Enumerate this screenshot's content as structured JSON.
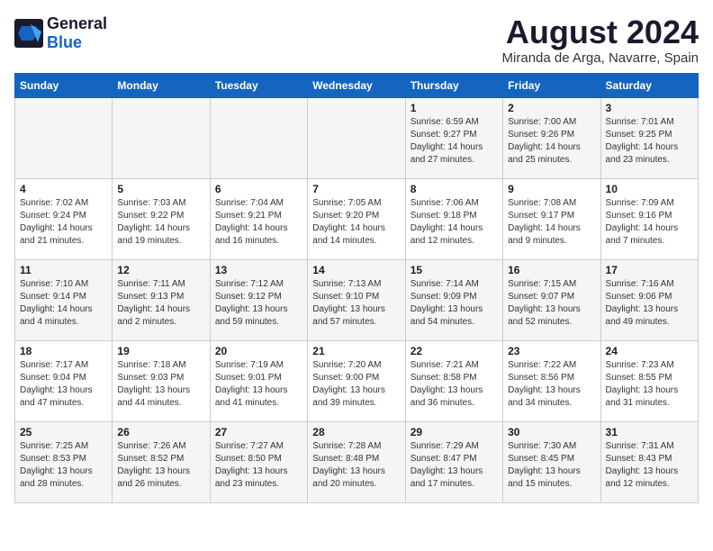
{
  "logo": {
    "general": "General",
    "blue": "Blue"
  },
  "title": {
    "month_year": "August 2024",
    "location": "Miranda de Arga, Navarre, Spain"
  },
  "days_of_week": [
    "Sunday",
    "Monday",
    "Tuesday",
    "Wednesday",
    "Thursday",
    "Friday",
    "Saturday"
  ],
  "weeks": [
    [
      {
        "day": "",
        "info": ""
      },
      {
        "day": "",
        "info": ""
      },
      {
        "day": "",
        "info": ""
      },
      {
        "day": "",
        "info": ""
      },
      {
        "day": "1",
        "info": "Sunrise: 6:59 AM\nSunset: 9:27 PM\nDaylight: 14 hours and 27 minutes."
      },
      {
        "day": "2",
        "info": "Sunrise: 7:00 AM\nSunset: 9:26 PM\nDaylight: 14 hours and 25 minutes."
      },
      {
        "day": "3",
        "info": "Sunrise: 7:01 AM\nSunset: 9:25 PM\nDaylight: 14 hours and 23 minutes."
      }
    ],
    [
      {
        "day": "4",
        "info": "Sunrise: 7:02 AM\nSunset: 9:24 PM\nDaylight: 14 hours and 21 minutes."
      },
      {
        "day": "5",
        "info": "Sunrise: 7:03 AM\nSunset: 9:22 PM\nDaylight: 14 hours and 19 minutes."
      },
      {
        "day": "6",
        "info": "Sunrise: 7:04 AM\nSunset: 9:21 PM\nDaylight: 14 hours and 16 minutes."
      },
      {
        "day": "7",
        "info": "Sunrise: 7:05 AM\nSunset: 9:20 PM\nDaylight: 14 hours and 14 minutes."
      },
      {
        "day": "8",
        "info": "Sunrise: 7:06 AM\nSunset: 9:18 PM\nDaylight: 14 hours and 12 minutes."
      },
      {
        "day": "9",
        "info": "Sunrise: 7:08 AM\nSunset: 9:17 PM\nDaylight: 14 hours and 9 minutes."
      },
      {
        "day": "10",
        "info": "Sunrise: 7:09 AM\nSunset: 9:16 PM\nDaylight: 14 hours and 7 minutes."
      }
    ],
    [
      {
        "day": "11",
        "info": "Sunrise: 7:10 AM\nSunset: 9:14 PM\nDaylight: 14 hours and 4 minutes."
      },
      {
        "day": "12",
        "info": "Sunrise: 7:11 AM\nSunset: 9:13 PM\nDaylight: 14 hours and 2 minutes."
      },
      {
        "day": "13",
        "info": "Sunrise: 7:12 AM\nSunset: 9:12 PM\nDaylight: 13 hours and 59 minutes."
      },
      {
        "day": "14",
        "info": "Sunrise: 7:13 AM\nSunset: 9:10 PM\nDaylight: 13 hours and 57 minutes."
      },
      {
        "day": "15",
        "info": "Sunrise: 7:14 AM\nSunset: 9:09 PM\nDaylight: 13 hours and 54 minutes."
      },
      {
        "day": "16",
        "info": "Sunrise: 7:15 AM\nSunset: 9:07 PM\nDaylight: 13 hours and 52 minutes."
      },
      {
        "day": "17",
        "info": "Sunrise: 7:16 AM\nSunset: 9:06 PM\nDaylight: 13 hours and 49 minutes."
      }
    ],
    [
      {
        "day": "18",
        "info": "Sunrise: 7:17 AM\nSunset: 9:04 PM\nDaylight: 13 hours and 47 minutes."
      },
      {
        "day": "19",
        "info": "Sunrise: 7:18 AM\nSunset: 9:03 PM\nDaylight: 13 hours and 44 minutes."
      },
      {
        "day": "20",
        "info": "Sunrise: 7:19 AM\nSunset: 9:01 PM\nDaylight: 13 hours and 41 minutes."
      },
      {
        "day": "21",
        "info": "Sunrise: 7:20 AM\nSunset: 9:00 PM\nDaylight: 13 hours and 39 minutes."
      },
      {
        "day": "22",
        "info": "Sunrise: 7:21 AM\nSunset: 8:58 PM\nDaylight: 13 hours and 36 minutes."
      },
      {
        "day": "23",
        "info": "Sunrise: 7:22 AM\nSunset: 8:56 PM\nDaylight: 13 hours and 34 minutes."
      },
      {
        "day": "24",
        "info": "Sunrise: 7:23 AM\nSunset: 8:55 PM\nDaylight: 13 hours and 31 minutes."
      }
    ],
    [
      {
        "day": "25",
        "info": "Sunrise: 7:25 AM\nSunset: 8:53 PM\nDaylight: 13 hours and 28 minutes."
      },
      {
        "day": "26",
        "info": "Sunrise: 7:26 AM\nSunset: 8:52 PM\nDaylight: 13 hours and 26 minutes."
      },
      {
        "day": "27",
        "info": "Sunrise: 7:27 AM\nSunset: 8:50 PM\nDaylight: 13 hours and 23 minutes."
      },
      {
        "day": "28",
        "info": "Sunrise: 7:28 AM\nSunset: 8:48 PM\nDaylight: 13 hours and 20 minutes."
      },
      {
        "day": "29",
        "info": "Sunrise: 7:29 AM\nSunset: 8:47 PM\nDaylight: 13 hours and 17 minutes."
      },
      {
        "day": "30",
        "info": "Sunrise: 7:30 AM\nSunset: 8:45 PM\nDaylight: 13 hours and 15 minutes."
      },
      {
        "day": "31",
        "info": "Sunrise: 7:31 AM\nSunset: 8:43 PM\nDaylight: 13 hours and 12 minutes."
      }
    ]
  ]
}
